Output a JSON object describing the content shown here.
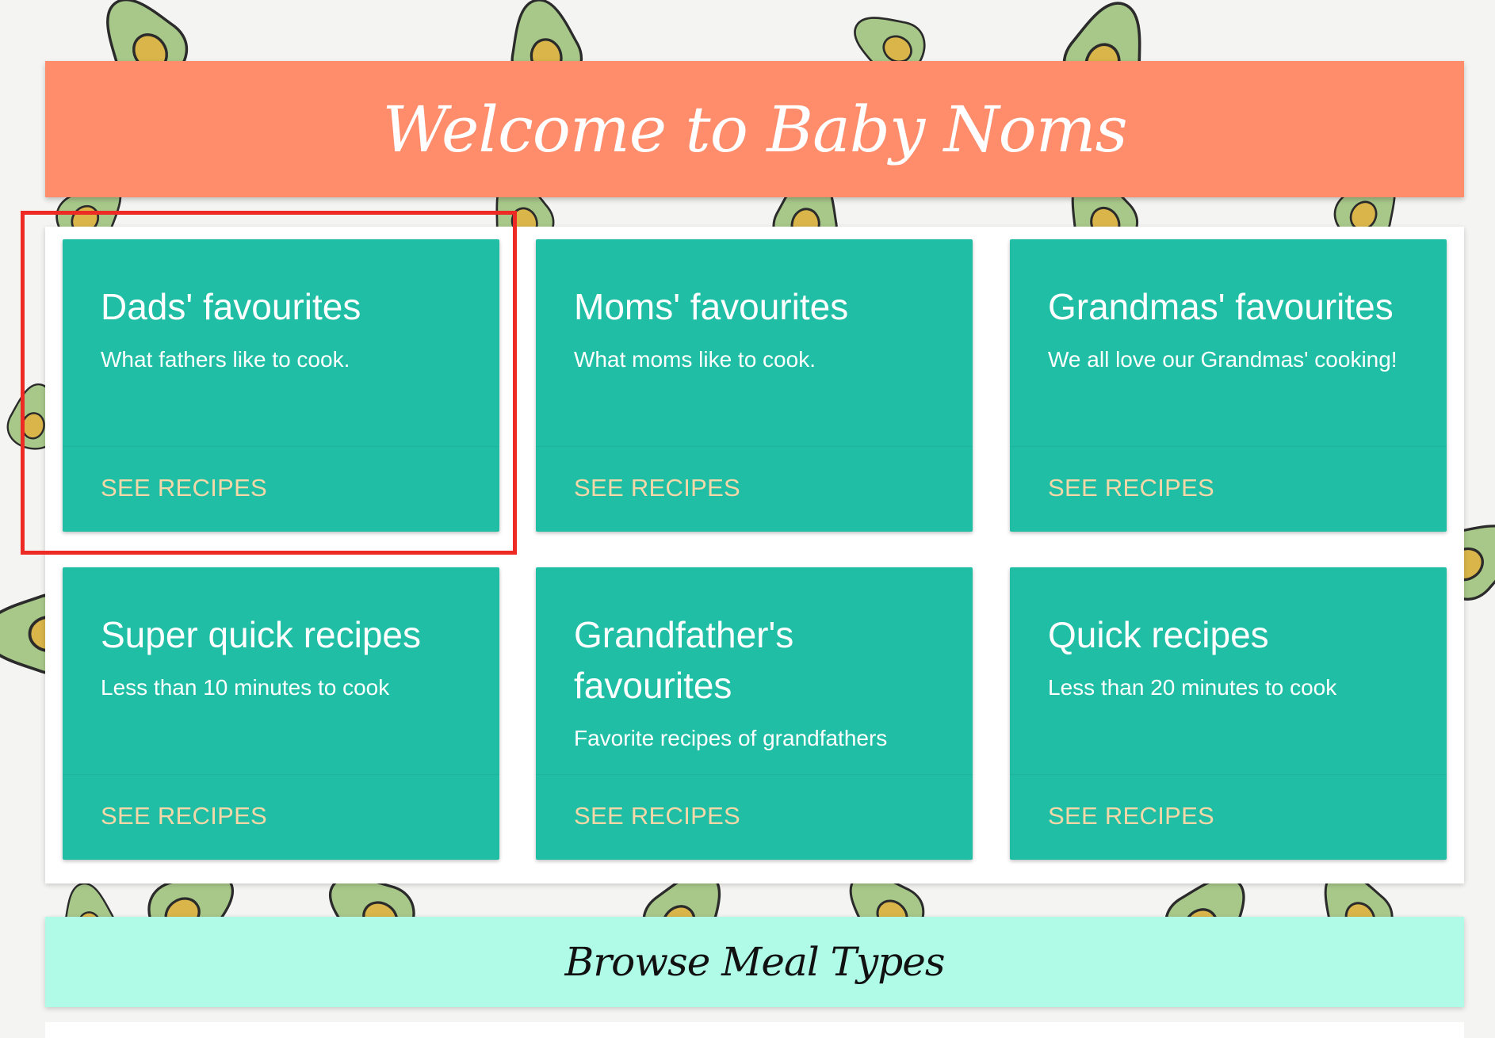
{
  "header": {
    "title": "Welcome to Baby Noms"
  },
  "cards": [
    {
      "title": "Dads' favourites",
      "description": "What fathers like to cook.",
      "action_label": "SEE RECIPES"
    },
    {
      "title": "Moms' favourites",
      "description": "What moms like to cook.",
      "action_label": "SEE RECIPES"
    },
    {
      "title": "Grandmas' favourites",
      "description": "We all love our Grandmas' cooking!",
      "action_label": "SEE RECIPES"
    },
    {
      "title": "Super quick recipes",
      "description": "Less than 10 minutes to cook",
      "action_label": "SEE RECIPES"
    },
    {
      "title": "Grandfather's favourites",
      "description": "Favorite recipes of grandfathers",
      "action_label": "SEE RECIPES"
    },
    {
      "title": "Quick recipes",
      "description": "Less than 20 minutes to cook",
      "action_label": "SEE RECIPES"
    }
  ],
  "browse": {
    "title": "Browse Meal Types"
  },
  "colors": {
    "header_bg": "#ff8c6b",
    "card_bg": "#20bfa5",
    "card_action": "#f5d7a8",
    "browse_bg": "#b0fbe8",
    "highlight": "#ee2a24",
    "avocado_skin": "#a8c88a",
    "avocado_pit": "#d9b54a"
  },
  "background": {
    "pattern": "avocado-icon"
  }
}
